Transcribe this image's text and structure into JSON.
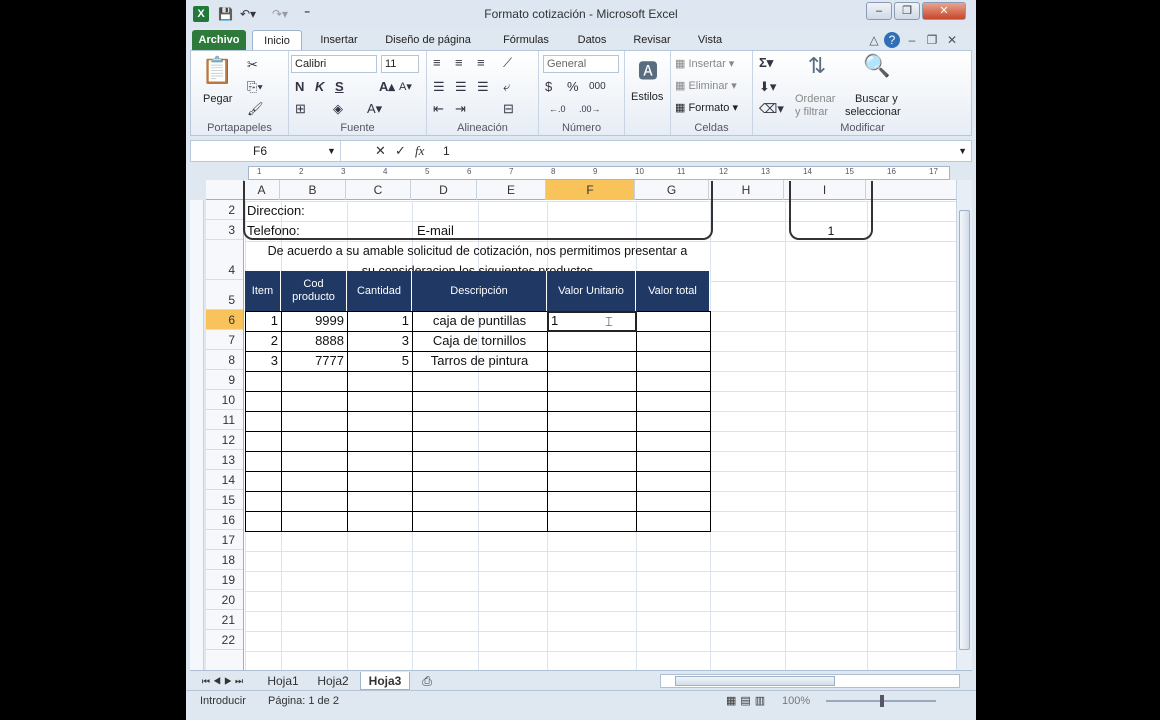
{
  "window": {
    "title": "Formato cotización - Microsoft Excel"
  },
  "tabs": [
    "Archivo",
    "Inicio",
    "Insertar",
    "Diseño de página",
    "Fórmulas",
    "Datos",
    "Revisar",
    "Vista"
  ],
  "ribbon": {
    "pegar": "Pegar",
    "portapapeles": "Portapapeles",
    "font_name": "Calibri",
    "font_size": "11",
    "fuente": "Fuente",
    "alineacion": "Alineación",
    "number_format": "General",
    "numero": "Número",
    "estilos": "Estilos",
    "insertar": "Insertar",
    "eliminar": "Eliminar",
    "formato": "Formato",
    "celdas": "Celdas",
    "ordenar1": "Ordenar",
    "ordenar2": "y filtrar",
    "buscar1": "Buscar y",
    "buscar2": "seleccionar",
    "modificar": "Modificar",
    "bold": "N",
    "italic": "K",
    "underline": "S"
  },
  "formula_bar": {
    "name_box": "F6",
    "fx": "fx",
    "value": "1"
  },
  "ruler": [
    "1",
    "2",
    "3",
    "4",
    "5",
    "6",
    "7",
    "8",
    "9",
    "10",
    "11",
    "12",
    "13",
    "14",
    "15",
    "16",
    "17"
  ],
  "columns": [
    "A",
    "B",
    "C",
    "D",
    "E",
    "F",
    "G",
    "H",
    "I"
  ],
  "rows": [
    "2",
    "3",
    "4",
    "5",
    "6",
    "7",
    "8",
    "9",
    "10",
    "11",
    "12",
    "13",
    "14",
    "15",
    "16",
    "17",
    "18",
    "19",
    "20",
    "21",
    "22"
  ],
  "sheet": {
    "direccion": "Direccion:",
    "telefono": "Telefono:",
    "email": "E-mail",
    "i3": "1",
    "intro1": "De acuerdo a su amable solicitud de cotización, nos permitimos presentar a",
    "intro2": "su consideracion los siguientes productos",
    "headers": {
      "item": "Item",
      "cod1": "Cod",
      "cod2": "producto",
      "cantidad": "Cantidad",
      "descripcion": "Descripción",
      "valor_unitario": "Valor Unitario",
      "valor_total": "Valor total"
    },
    "items": [
      {
        "item": "1",
        "cod": "9999",
        "cantidad": "1",
        "desc": "caja de puntillas"
      },
      {
        "item": "2",
        "cod": "8888",
        "cantidad": "3",
        "desc": "Caja de tornillos"
      },
      {
        "item": "3",
        "cod": "7777",
        "cantidad": "5",
        "desc": "Tarros de pintura"
      }
    ],
    "editing_value": "1"
  },
  "sheet_tabs": [
    "Hoja1",
    "Hoja2",
    "Hoja3"
  ],
  "status": {
    "mode": "Introducir",
    "page": "Página: 1 de 2",
    "zoom": "100%"
  }
}
